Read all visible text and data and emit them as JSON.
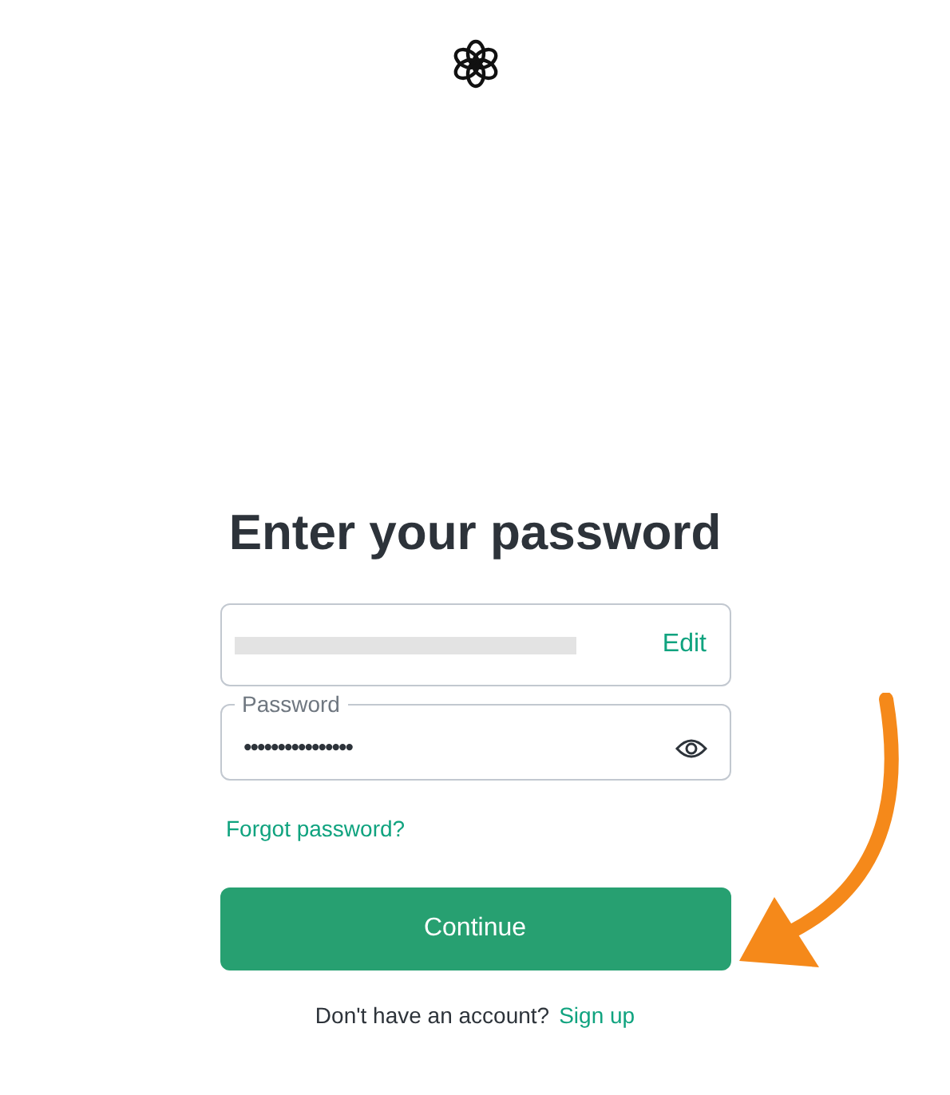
{
  "heading": "Enter your password",
  "email_field": {
    "redacted": true,
    "action": "Edit"
  },
  "password_field": {
    "label": "Password",
    "value": "••••••••••••••••"
  },
  "forgot_link": "Forgot password?",
  "continue_button": "Continue",
  "footer": {
    "text": "Don't have an account?",
    "link": "Sign up"
  },
  "annotation": {
    "kind": "arrow"
  }
}
